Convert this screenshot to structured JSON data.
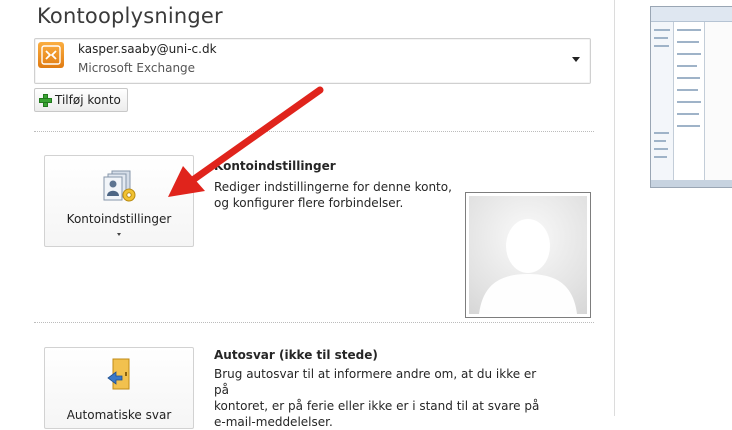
{
  "page": {
    "title": "Kontooplysninger"
  },
  "account": {
    "email": "kasper.saaby@uni-c.dk",
    "type": "Microsoft Exchange"
  },
  "add_account": {
    "label": "Tilføj konto"
  },
  "account_settings": {
    "button_label": "Kontoindstillinger",
    "heading": "Kontoindstillinger",
    "description_line1": "Rediger indstillingerne for denne konto,",
    "description_line2": "og konfigurer flere forbindelser."
  },
  "auto_reply": {
    "button_label": "Automatiske svar",
    "heading": "Autosvar (ikke til stede)",
    "description_line1": "Brug autosvar til at informere andre om, at du ikke er på",
    "description_line2": "kontoret, er på ferie eller ikke er i stand til at svare på",
    "description_line3": "e-mail-meddelelser."
  },
  "colors": {
    "annotation_arrow": "#e0241c",
    "exchange_icon": "#f0901f",
    "add_icon": "#3aa433"
  },
  "icons": [
    "exchange-icon",
    "add-icon",
    "account-settings-icon",
    "auto-reply-icon",
    "avatar-placeholder",
    "dropdown-arrow-icon"
  ]
}
